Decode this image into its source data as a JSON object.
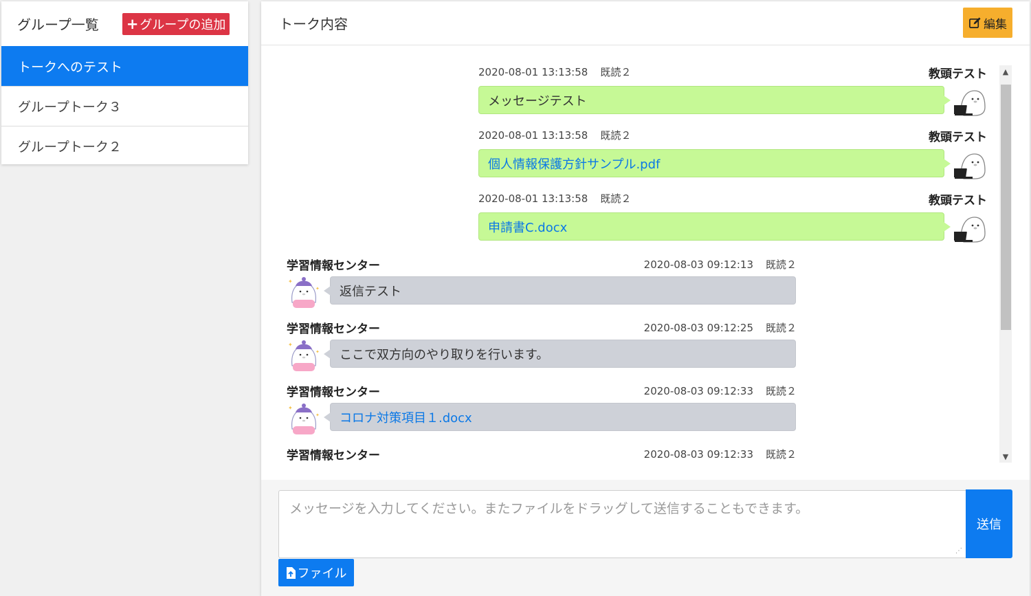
{
  "sidebar": {
    "title": "グループ一覧",
    "add_button_label": "グループの追加",
    "groups": [
      {
        "label": "トークへのテスト",
        "active": true
      },
      {
        "label": "グループトーク３"
      },
      {
        "label": "グループトーク２"
      }
    ]
  },
  "talk": {
    "title": "トーク内容",
    "edit_label": "編集",
    "messages": [
      {
        "sender": "教頭テスト",
        "time": "2020-08-01 13:13:58",
        "read": "既読２",
        "text": "メッセージテスト",
        "is_link": false,
        "self": true
      },
      {
        "sender": "教頭テスト",
        "time": "2020-08-01 13:13:58",
        "read": "既読２",
        "text": "個人情報保護方針サンプル.pdf",
        "is_link": true,
        "self": true
      },
      {
        "sender": "教頭テスト",
        "time": "2020-08-01 13:13:58",
        "read": "既読２",
        "text": "申請書C.docx",
        "is_link": true,
        "self": true
      },
      {
        "sender": "学習情報センター",
        "time": "2020-08-03 09:12:13",
        "read": "既読２",
        "text": "返信テスト",
        "is_link": false,
        "self": false
      },
      {
        "sender": "学習情報センター",
        "time": "2020-08-03 09:12:25",
        "read": "既読２",
        "text": "ここで双方向のやり取りを行います。",
        "is_link": false,
        "self": false
      },
      {
        "sender": "学習情報センター",
        "time": "2020-08-03 09:12:33",
        "read": "既読２",
        "text": "コロナ対策項目１.docx",
        "is_link": true,
        "self": false
      },
      {
        "sender": "学習情報センター",
        "time": "2020-08-03 09:12:33",
        "read": "既読２",
        "text": "",
        "is_link": false,
        "self": false
      }
    ]
  },
  "composer": {
    "placeholder": "メッセージを入力してください。またファイルをドラッグして送信することもできます。",
    "value": "",
    "send_label": "送信",
    "file_label": "ファイル"
  },
  "colors": {
    "primary": "#0d7bf0",
    "danger": "#dc3545",
    "warning": "#f6ae2d",
    "self_bubble": "#c6f996",
    "other_bubble": "#ced1d8",
    "link": "#0b78e6"
  },
  "icons": {
    "add": "plus-icon",
    "edit": "edit-icon",
    "file": "file-upload-icon",
    "self_avatar": "seal-laptop-avatar",
    "other_avatar": "seal-beanie-avatar"
  }
}
